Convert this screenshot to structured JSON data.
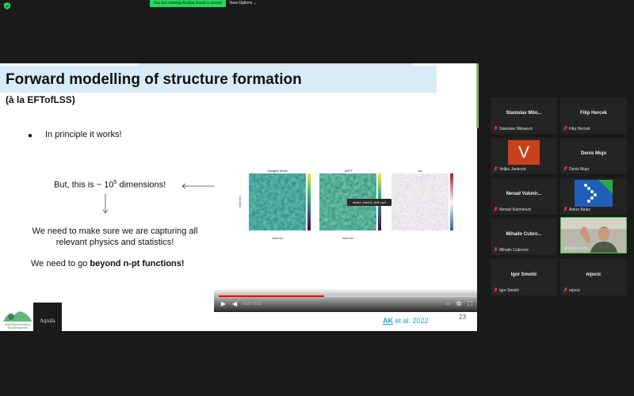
{
  "top_bar": {
    "viewing_banner": "You are viewing Andrija Kostic's screen",
    "view_options": "View Options ⌄"
  },
  "slide": {
    "title": "Forward modelling of structure formation",
    "subtitle": "(à la EFTofLSS)",
    "bullet": "In principle it works!",
    "dims_prefix": "But, this is ~ 10",
    "dims_exp": "5",
    "dims_suffix": " dimensions!",
    "make_sure_line1": "We need to make sure we are capturing all",
    "make_sure_line2": "relevant physics and statistics!",
    "beyond_prefix": "We need to go ",
    "beyond_bold": "beyond n-pt functions!",
    "tooltip": "movie_batch2_all3.mp4",
    "citation_author": "AK",
    "citation_rest": " et al. 2022",
    "page_number": "23",
    "logo2_text": "Aquila",
    "fields": {
      "panel_titles": [
        "Gauged result",
        "ΔEFT",
        "Δd"
      ],
      "x_axis_label": "mesh bin",
      "y_axis_label": "mesh bin"
    }
  },
  "player": {
    "progress": 0.41,
    "time_text": "0:00 / 0:12"
  },
  "participants": [
    {
      "name": "Stanislav Milo...",
      "label": "Stanislav Milosevic",
      "muted": true
    },
    {
      "name": "Filip Hercek",
      "label": "Filip Hercek",
      "muted": true
    },
    {
      "name": "",
      "label": "Veljko Jankovic",
      "muted": true,
      "avatar_letter": "V"
    },
    {
      "name": "Denis Mujo",
      "label": "Denis Mujo",
      "muted": true
    },
    {
      "name": "Nenad Vukmir...",
      "label": "Nenad Vukmirovic",
      "muted": true
    },
    {
      "name": "",
      "label": "Antun Balaz",
      "muted": true
    },
    {
      "name": "Mihailo Cubro...",
      "label": "Mihailo Cubrovic",
      "muted": true
    },
    {
      "name": "",
      "label": "Andrija Kostic",
      "muted": false
    },
    {
      "name": "Igor Smolić",
      "label": "Igor Smolić",
      "muted": true
    },
    {
      "name": "mjocic",
      "label": "mjocic",
      "muted": true
    }
  ],
  "colors": {
    "banner_green": "#23d959",
    "title_band": "#d8ecf7",
    "active_speaker": "#3ec94a",
    "citation": "#1fa3c9",
    "progress": "#ff0000"
  }
}
